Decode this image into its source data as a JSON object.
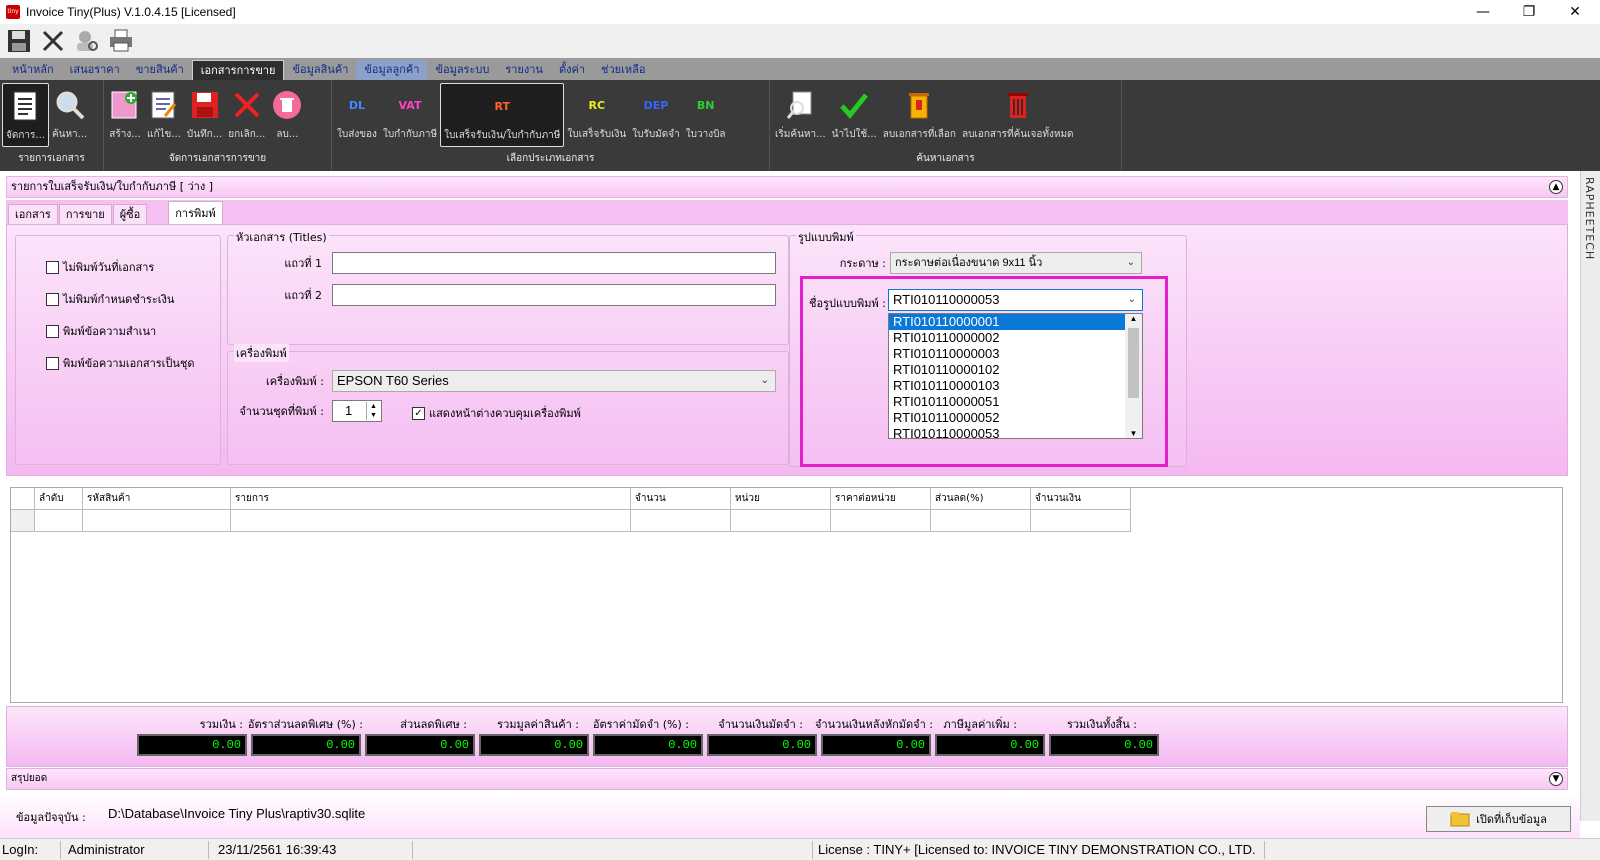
{
  "window": {
    "title": "Invoice Tiny(Plus)  V.1.0.4.15 [Licensed]",
    "logo_text": "tiny"
  },
  "menu_tabs": [
    "หน้าหลัก",
    "เสนอราคา",
    "ขายสินค้า",
    "เอกสารการขาย",
    "ข้อมูลสินค้า",
    "ข้อมูลลูกค้า",
    "ข้อมูลระบบ",
    "รายงาน",
    "ตั้งค่า",
    "ช่วยเหลือ"
  ],
  "ribbon": {
    "group1": {
      "label": "รายการเอกสาร",
      "buttons": [
        "จัดการ...",
        "ค้นหา..."
      ]
    },
    "group2": {
      "label": "จัดการเอกสารการขาย",
      "buttons": [
        "สร้าง...",
        "แก้ไข...",
        "บันทึก...",
        "ยกเลิก...",
        "ลบ..."
      ]
    },
    "group3": {
      "label": "เลือกประเภทเอกสาร",
      "buttons": [
        "ใบส่งของ",
        "ใบกำกับภาษี",
        "ใบเสร็จรับเงิน/ใบกำกับภาษี",
        "ใบเสร็จรับเงิน",
        "ใบรับมัดจำ",
        "ใบวางบิล"
      ],
      "icon_codes": [
        "DL",
        "VAT",
        "RT",
        "RC",
        "DEP",
        "BN"
      ]
    },
    "group4": {
      "label": "ค้นหาเอกสาร",
      "buttons": [
        "เริ่มค้นหา...",
        "นำไปใช้...",
        "ลบเอกสารที่เลือก",
        "ลบเอกสารที่ค้นเจอทั้งหมด"
      ]
    }
  },
  "side_label": "RAPHEETECH",
  "doc_header": "รายการใบเสร็จรับเงิน/ใบกำกับภาษี [ ว่าง ]",
  "doc_tabs": [
    "เอกสาร",
    "การขาย",
    "ผู้ซื้อ",
    "การพิมพ์"
  ],
  "print_options": {
    "checkboxes": [
      "ไม่พิมพ์วันที่เอกสาร",
      "ไม่พิมพ์กำหนดชำระเงิน",
      "พิมพ์ข้อความสำเนา",
      "พิมพ์ข้อความเอกสารเป็นชุด"
    ]
  },
  "titles_group": {
    "title": "หัวเอกสาร (Titles)",
    "line1_label": "แถวที่ 1",
    "line2_label": "แถวที่ 2",
    "line1_value": "",
    "line2_value": ""
  },
  "printer_group": {
    "title": "เครื่องพิมพ์",
    "printer_label": "เครื่องพิมพ์ :",
    "printer_value": "EPSON T60 Series",
    "copies_label": "จำนวนชุดที่พิมพ์ :",
    "copies_value": "1",
    "show_dialog_label": "แสดงหน้าต่างควบคุมเครื่องพิมพ์",
    "show_dialog_checked": true
  },
  "format_group": {
    "title": "รูปแบบพิมพ์",
    "paper_label": "กระดาษ :",
    "paper_value": "กระดาษต่อเนื่องขนาด 9x11 นิ้ว",
    "format_label": "ชื่อรูปแบบพิมพ์ :",
    "format_value": "RTI010110000053",
    "options": [
      "RTI010110000001",
      "RTI010110000002",
      "RTI010110000003",
      "RTI010110000102",
      "RTI010110000103",
      "RTI010110000051",
      "RTI010110000052",
      "RTI010110000053"
    ],
    "selected_index": 0
  },
  "grid": {
    "columns": [
      "ลำดับ",
      "รหัสสินค้า",
      "รายการ",
      "จำนวน",
      "หน่วย",
      "ราคาต่อหน่วย",
      "ส่วนลด(%)",
      "จำนวนเงิน"
    ]
  },
  "totals": {
    "labels": [
      "รวมเงิน :",
      "อัตราส่วนลดพิเศษ (%) :",
      "ส่วนลดพิเศษ :",
      "รวมมูลค่าสินค้า :",
      "อัตราค่ามัดจำ (%) :",
      "จำนวนเงินมัดจำ :",
      "จำนวนเงินหลังหักมัดจำ :",
      "ภาษีมูลค่าเพิ่ม :",
      "รวมเงินทั้งสิ้น :"
    ],
    "values": [
      "0.00",
      "0.00",
      "0.00",
      "0.00",
      "0.00",
      "0.00",
      "0.00",
      "0.00",
      "0.00"
    ]
  },
  "summary_label": "สรุปยอด",
  "db": {
    "label": "ข้อมูลปัจจุบัน :",
    "path": "D:\\Database\\Invoice Tiny Plus\\raptiv30.sqlite",
    "open_button": "เปิดที่เก็บข้อมูล"
  },
  "status": {
    "login_label": "LogIn:",
    "user": "Administrator",
    "datetime": "23/11/2561 16:39:43",
    "license": "License : TINY+ [Licensed to: INVOICE TINY DEMONSTRATION CO., LTD."
  },
  "colors": {
    "accent_pink": "#e020c8",
    "panel_pink": "#f5b8f1",
    "ribbon_dark": "#3a3a3a",
    "selection_blue": "#0a78d7"
  }
}
